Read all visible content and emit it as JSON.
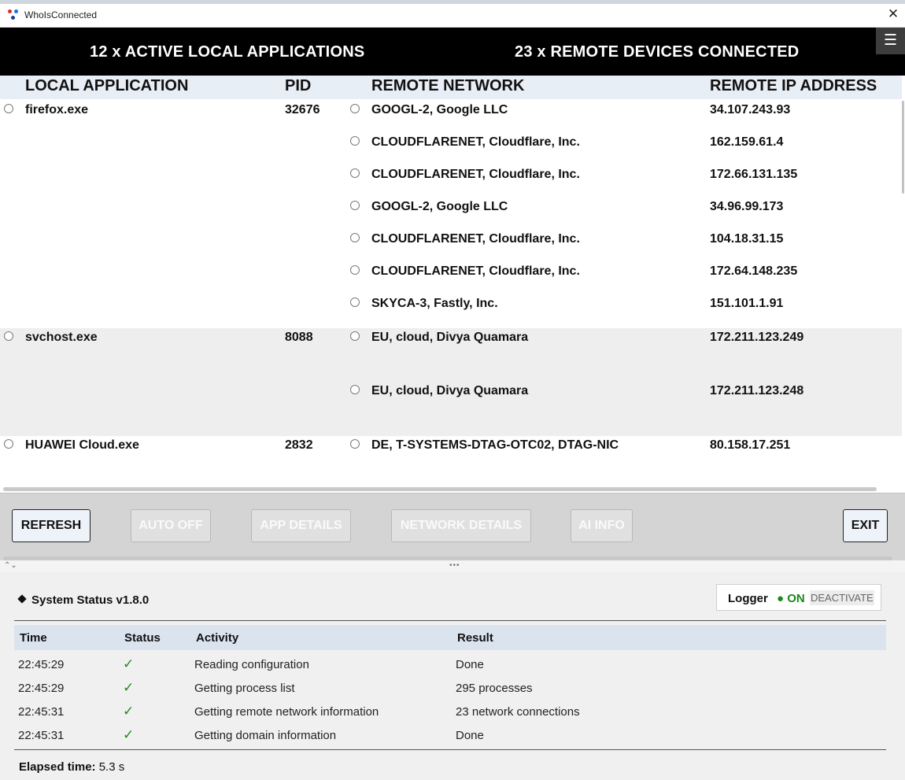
{
  "window": {
    "title": "WhoIsConnected",
    "close_glyph": "✕"
  },
  "banner": {
    "local_apps": "12 x ACTIVE LOCAL APPLICATIONS",
    "remote_devices": "23 x REMOTE DEVICES CONNECTED",
    "menu_glyph": "☰"
  },
  "table": {
    "headers": {
      "app": "LOCAL APPLICATION",
      "pid": "PID",
      "network": "REMOTE NETWORK",
      "ip": "REMOTE IP ADDRESS"
    },
    "groups": [
      {
        "app": "firefox.exe",
        "pid": "32676",
        "connections": [
          {
            "network": "GOOGL-2, Google LLC",
            "ip": "34.107.243.93"
          },
          {
            "network": "CLOUDFLARENET, Cloudflare, Inc.",
            "ip": "162.159.61.4"
          },
          {
            "network": "CLOUDFLARENET, Cloudflare, Inc.",
            "ip": "172.66.131.135"
          },
          {
            "network": "GOOGL-2, Google LLC",
            "ip": "34.96.99.173"
          },
          {
            "network": "CLOUDFLARENET, Cloudflare, Inc.",
            "ip": "104.18.31.15"
          },
          {
            "network": "CLOUDFLARENET, Cloudflare, Inc.",
            "ip": "172.64.148.235"
          },
          {
            "network": "SKYCA-3, Fastly, Inc.",
            "ip": "151.101.1.91"
          }
        ]
      },
      {
        "app": "svchost.exe",
        "pid": "8088",
        "connections": [
          {
            "network": "EU, cloud, Divya Quamara",
            "ip": "172.211.123.249"
          },
          {
            "network": "EU, cloud, Divya Quamara",
            "ip": "172.211.123.248"
          }
        ]
      },
      {
        "app": "HUAWEI Cloud.exe",
        "pid": "2832",
        "connections": [
          {
            "network": "DE, T-SYSTEMS-DTAG-OTC02, DTAG-NIC",
            "ip": "80.158.17.251"
          }
        ]
      }
    ]
  },
  "buttons": {
    "refresh": "REFRESH",
    "auto": "AUTO OFF",
    "app_details": "APP DETAILS",
    "network_details": "NETWORK DETAILS",
    "ai_info": "AI INFO",
    "exit": "EXIT"
  },
  "status": {
    "title": "System Status v1.8.0",
    "logger_label": "Logger",
    "logger_state": "● ON",
    "logger_action": "DEACTIVATE",
    "columns": {
      "time": "Time",
      "status": "Status",
      "activity": "Activity",
      "result": "Result"
    },
    "rows": [
      {
        "time": "22:45:29",
        "status": "✓",
        "activity": "Reading configuration",
        "result": "Done"
      },
      {
        "time": "22:45:29",
        "status": "✓",
        "activity": "Getting process list",
        "result": "295 processes"
      },
      {
        "time": "22:45:31",
        "status": "✓",
        "activity": "Getting remote network information",
        "result": "23 network connections"
      },
      {
        "time": "22:45:31",
        "status": "✓",
        "activity": "Getting domain information",
        "result": "Done"
      }
    ],
    "elapsed_label": "Elapsed time:",
    "elapsed_value": "5.3 s"
  },
  "colors": {
    "banner_bg": "#000000",
    "header_bg": "#e8eef6",
    "alt_row_bg": "#eeeeee",
    "logger_on": "#188a18",
    "check": "#1c8a1c"
  }
}
